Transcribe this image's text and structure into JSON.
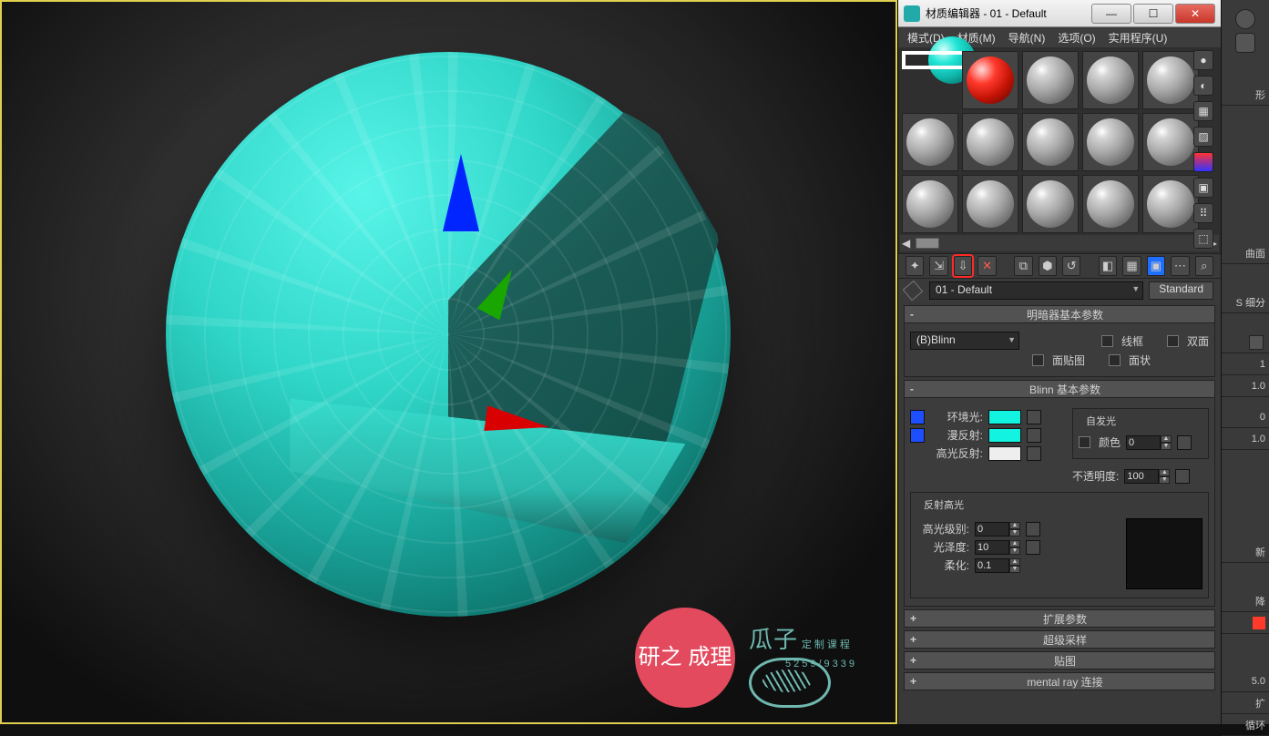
{
  "viewport": {
    "watermark_circle": "研之\n成理",
    "watermark_brand": "瓜子",
    "watermark_sub1": "定制课程",
    "watermark_sub2": "5259/9339"
  },
  "window": {
    "title": "材质编辑器 - 01 - Default",
    "buttons": {
      "min": "—",
      "max": "☐",
      "close": "✕"
    }
  },
  "menu": {
    "mode": "模式(D)",
    "material": "材质(M)",
    "nav": "导航(N)",
    "options": "选项(O)",
    "util": "实用程序(U)"
  },
  "toolbar": {
    "get": "✦",
    "put": "⇲",
    "assign": "⇩",
    "assign_sel": "⬢",
    "reset": "↺",
    "del": "✕",
    "make": "⧉",
    "show": "◧",
    "showMap": "▦",
    "back": "◀",
    "fwd": "▶",
    "go": "▣",
    "opts": "⋯",
    "pick": "⌕"
  },
  "material": {
    "name": "01 - Default",
    "type": "Standard",
    "shader_roll": "明暗器基本参数",
    "shader": "(B)Blinn",
    "wire_label": "线框",
    "face_label": "面贴图",
    "twoSide_label": "双面",
    "faceted_label": "面状",
    "blinn_roll": "Blinn 基本参数",
    "ambient_label": "环境光:",
    "diffuse_label": "漫反射:",
    "specular_label": "高光反射:",
    "selfillum_title": "自发光",
    "selfillum_color_label": "颜色",
    "selfillum_value": "0",
    "opacity_label": "不透明度:",
    "opacity_value": "100",
    "spec_title": "反射高光",
    "spec_level_label": "高光级别:",
    "spec_level": "0",
    "gloss_label": "光泽度:",
    "gloss": "10",
    "soften_label": "柔化:",
    "soften": "0.1",
    "rolls": {
      "ext": "扩展参数",
      "ss": "超级采样",
      "maps": "贴图",
      "mr": "mental ray 连接"
    }
  },
  "rstrip": {
    "lab1": "形",
    "lab2": "曲面",
    "lab3": "S 细分",
    "v1": "1",
    "v2": "1.0",
    "v3": "0",
    "v4": "1.0",
    "lab4": "新",
    "lab5": "降",
    "vf": "5.0",
    "b1": "扩",
    "b2": "循环"
  }
}
